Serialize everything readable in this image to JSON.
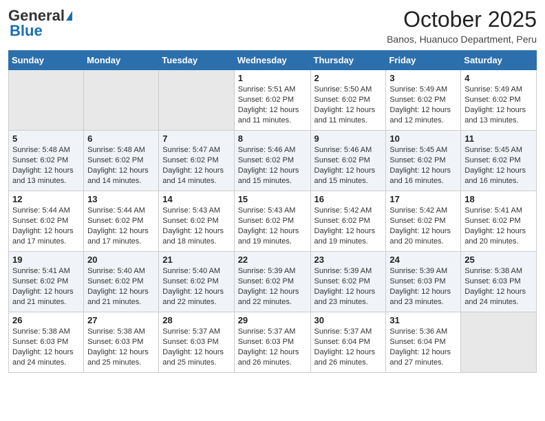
{
  "app": {
    "logo_general": "General",
    "logo_blue": "Blue",
    "month_title": "October 2025",
    "location": "Banos, Huanuco Department, Peru"
  },
  "calendar": {
    "headers": [
      "Sunday",
      "Monday",
      "Tuesday",
      "Wednesday",
      "Thursday",
      "Friday",
      "Saturday"
    ],
    "weeks": [
      [
        {
          "day": "",
          "info": ""
        },
        {
          "day": "",
          "info": ""
        },
        {
          "day": "",
          "info": ""
        },
        {
          "day": "1",
          "info": "Sunrise: 5:51 AM\nSunset: 6:02 PM\nDaylight: 12 hours\nand 11 minutes."
        },
        {
          "day": "2",
          "info": "Sunrise: 5:50 AM\nSunset: 6:02 PM\nDaylight: 12 hours\nand 11 minutes."
        },
        {
          "day": "3",
          "info": "Sunrise: 5:49 AM\nSunset: 6:02 PM\nDaylight: 12 hours\nand 12 minutes."
        },
        {
          "day": "4",
          "info": "Sunrise: 5:49 AM\nSunset: 6:02 PM\nDaylight: 12 hours\nand 13 minutes."
        }
      ],
      [
        {
          "day": "5",
          "info": "Sunrise: 5:48 AM\nSunset: 6:02 PM\nDaylight: 12 hours\nand 13 minutes."
        },
        {
          "day": "6",
          "info": "Sunrise: 5:48 AM\nSunset: 6:02 PM\nDaylight: 12 hours\nand 14 minutes."
        },
        {
          "day": "7",
          "info": "Sunrise: 5:47 AM\nSunset: 6:02 PM\nDaylight: 12 hours\nand 14 minutes."
        },
        {
          "day": "8",
          "info": "Sunrise: 5:46 AM\nSunset: 6:02 PM\nDaylight: 12 hours\nand 15 minutes."
        },
        {
          "day": "9",
          "info": "Sunrise: 5:46 AM\nSunset: 6:02 PM\nDaylight: 12 hours\nand 15 minutes."
        },
        {
          "day": "10",
          "info": "Sunrise: 5:45 AM\nSunset: 6:02 PM\nDaylight: 12 hours\nand 16 minutes."
        },
        {
          "day": "11",
          "info": "Sunrise: 5:45 AM\nSunset: 6:02 PM\nDaylight: 12 hours\nand 16 minutes."
        }
      ],
      [
        {
          "day": "12",
          "info": "Sunrise: 5:44 AM\nSunset: 6:02 PM\nDaylight: 12 hours\nand 17 minutes."
        },
        {
          "day": "13",
          "info": "Sunrise: 5:44 AM\nSunset: 6:02 PM\nDaylight: 12 hours\nand 17 minutes."
        },
        {
          "day": "14",
          "info": "Sunrise: 5:43 AM\nSunset: 6:02 PM\nDaylight: 12 hours\nand 18 minutes."
        },
        {
          "day": "15",
          "info": "Sunrise: 5:43 AM\nSunset: 6:02 PM\nDaylight: 12 hours\nand 19 minutes."
        },
        {
          "day": "16",
          "info": "Sunrise: 5:42 AM\nSunset: 6:02 PM\nDaylight: 12 hours\nand 19 minutes."
        },
        {
          "day": "17",
          "info": "Sunrise: 5:42 AM\nSunset: 6:02 PM\nDaylight: 12 hours\nand 20 minutes."
        },
        {
          "day": "18",
          "info": "Sunrise: 5:41 AM\nSunset: 6:02 PM\nDaylight: 12 hours\nand 20 minutes."
        }
      ],
      [
        {
          "day": "19",
          "info": "Sunrise: 5:41 AM\nSunset: 6:02 PM\nDaylight: 12 hours\nand 21 minutes."
        },
        {
          "day": "20",
          "info": "Sunrise: 5:40 AM\nSunset: 6:02 PM\nDaylight: 12 hours\nand 21 minutes."
        },
        {
          "day": "21",
          "info": "Sunrise: 5:40 AM\nSunset: 6:02 PM\nDaylight: 12 hours\nand 22 minutes."
        },
        {
          "day": "22",
          "info": "Sunrise: 5:39 AM\nSunset: 6:02 PM\nDaylight: 12 hours\nand 22 minutes."
        },
        {
          "day": "23",
          "info": "Sunrise: 5:39 AM\nSunset: 6:02 PM\nDaylight: 12 hours\nand 23 minutes."
        },
        {
          "day": "24",
          "info": "Sunrise: 5:39 AM\nSunset: 6:03 PM\nDaylight: 12 hours\nand 23 minutes."
        },
        {
          "day": "25",
          "info": "Sunrise: 5:38 AM\nSunset: 6:03 PM\nDaylight: 12 hours\nand 24 minutes."
        }
      ],
      [
        {
          "day": "26",
          "info": "Sunrise: 5:38 AM\nSunset: 6:03 PM\nDaylight: 12 hours\nand 24 minutes."
        },
        {
          "day": "27",
          "info": "Sunrise: 5:38 AM\nSunset: 6:03 PM\nDaylight: 12 hours\nand 25 minutes."
        },
        {
          "day": "28",
          "info": "Sunrise: 5:37 AM\nSunset: 6:03 PM\nDaylight: 12 hours\nand 25 minutes."
        },
        {
          "day": "29",
          "info": "Sunrise: 5:37 AM\nSunset: 6:03 PM\nDaylight: 12 hours\nand 26 minutes."
        },
        {
          "day": "30",
          "info": "Sunrise: 5:37 AM\nSunset: 6:04 PM\nDaylight: 12 hours\nand 26 minutes."
        },
        {
          "day": "31",
          "info": "Sunrise: 5:36 AM\nSunset: 6:04 PM\nDaylight: 12 hours\nand 27 minutes."
        },
        {
          "day": "",
          "info": ""
        }
      ]
    ]
  }
}
